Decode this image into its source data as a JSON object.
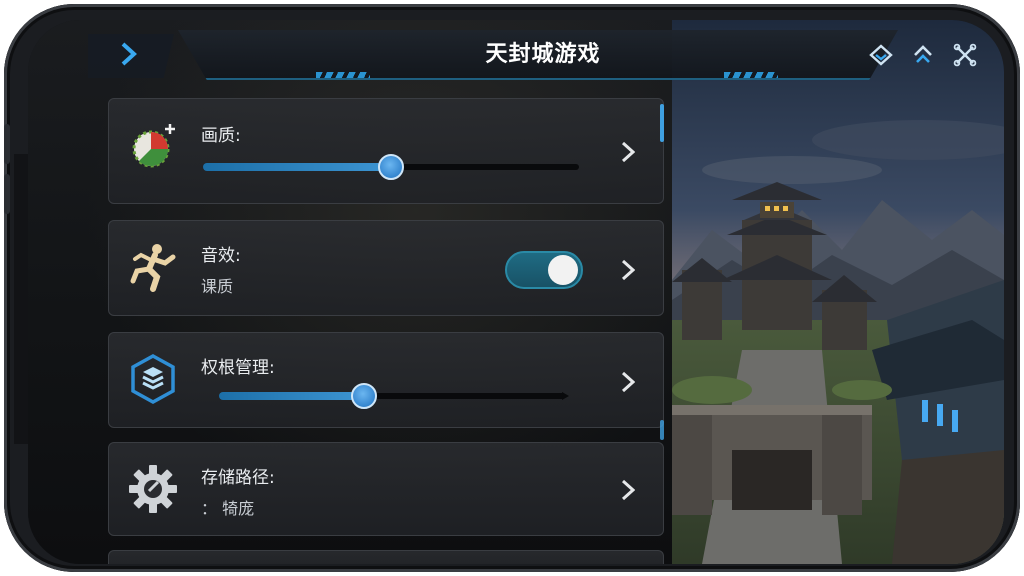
{
  "window": {
    "title": "天封城游戏"
  },
  "topbar": {
    "back_icon": "chevron-right-icon",
    "icons": [
      "diamond-layers-icon",
      "upward-chevrons-icon",
      "crossed-tools-icon"
    ]
  },
  "settings": {
    "items": [
      {
        "label": "画质:",
        "control": "slider",
        "value": 0.5,
        "icon": "quality-dial-icon"
      },
      {
        "label": "音效:",
        "sub": "课质",
        "control": "toggle",
        "toggle_on": true,
        "icon": "running-figure-icon"
      },
      {
        "label": "权根管理:",
        "control": "slider",
        "value": 0.42,
        "icon": "layers-hexagon-icon"
      },
      {
        "label": "存储路径:",
        "sub": "： 犄庞",
        "control": "none",
        "icon": "gear-icon"
      }
    ]
  },
  "colors": {
    "accent": "#3d95d3",
    "toggle": "#1f6b83",
    "panel": "#2a2c30",
    "background": "#101317"
  }
}
